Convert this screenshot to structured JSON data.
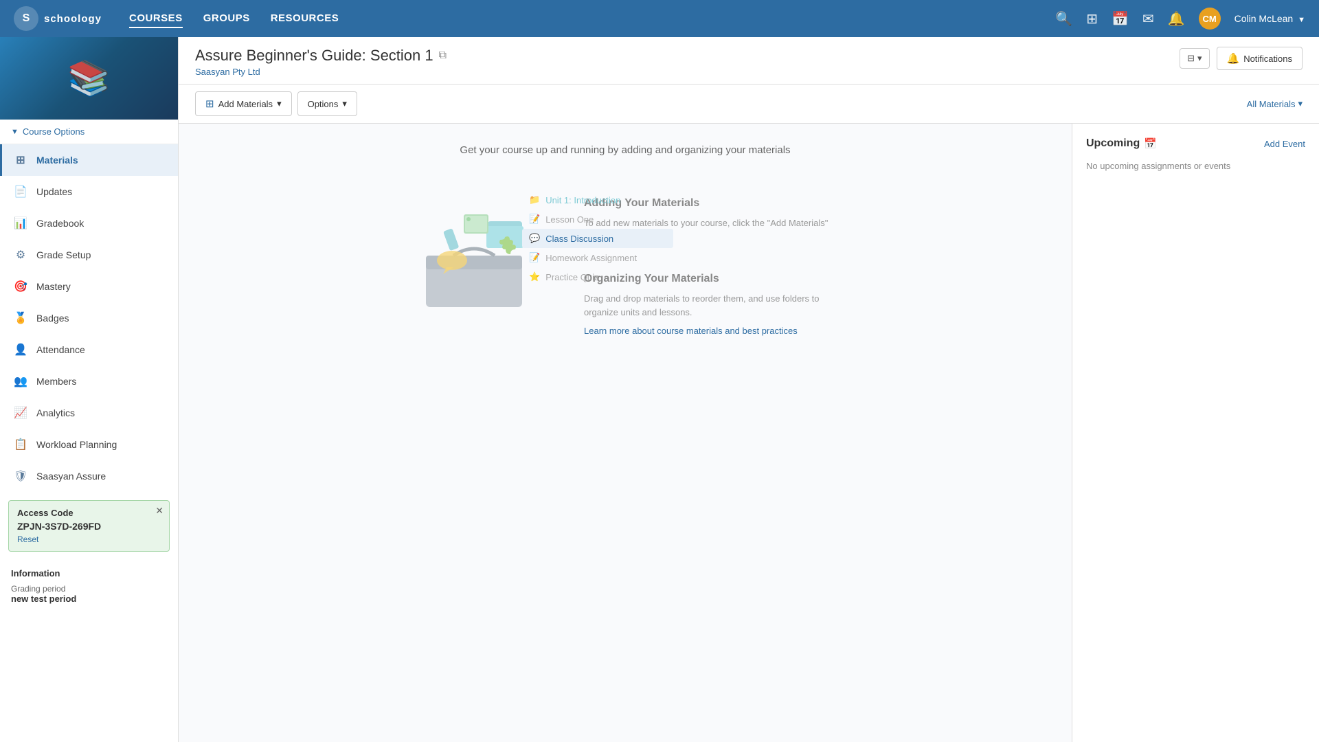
{
  "topNav": {
    "logo": "schoology",
    "links": [
      {
        "label": "COURSES",
        "active": true
      },
      {
        "label": "GROUPS",
        "active": false
      },
      {
        "label": "RESOURCES",
        "active": false
      }
    ],
    "user": {
      "name": "Colin McLean",
      "initials": "CM"
    },
    "icons": [
      "search",
      "apps",
      "calendar",
      "mail",
      "bell"
    ]
  },
  "pageHeader": {
    "title": "Assure Beginner's Guide: Section 1",
    "subtitle": "Saasyan Pty Ltd",
    "notificationsLabel": "Notifications"
  },
  "toolbar": {
    "addMaterials": "Add Materials",
    "options": "Options",
    "allMaterials": "All Materials"
  },
  "sidebar": {
    "courseOptions": "Course Options",
    "navItems": [
      {
        "label": "Materials",
        "icon": "grid",
        "active": true
      },
      {
        "label": "Updates",
        "icon": "file"
      },
      {
        "label": "Gradebook",
        "icon": "book"
      },
      {
        "label": "Grade Setup",
        "icon": "sliders"
      },
      {
        "label": "Mastery",
        "icon": "target"
      },
      {
        "label": "Badges",
        "icon": "badge"
      },
      {
        "label": "Attendance",
        "icon": "person"
      },
      {
        "label": "Members",
        "icon": "people"
      },
      {
        "label": "Analytics",
        "icon": "chart"
      },
      {
        "label": "Workload Planning",
        "icon": "calendar2"
      },
      {
        "label": "Saasyan Assure",
        "icon": "shield"
      }
    ],
    "accessCode": {
      "title": "Access Code",
      "value": "ZPJN-3S7D-269FD",
      "resetLabel": "Reset"
    },
    "information": {
      "title": "Information",
      "gradingPeriodLabel": "Grading period",
      "gradingPeriodValue": "new test period"
    }
  },
  "mainContent": {
    "emptyStateText": "Get your course up and running by adding and organizing your materials",
    "addingMaterials": {
      "title": "Adding Your Materials",
      "text": "To add new materials to your course, click the \"Add Materials\" dropdown menu."
    },
    "organizingMaterials": {
      "title": "Organizing Your Materials",
      "text": "Drag and drop materials to reorder them, and use folders to organize units and lessons.",
      "linkText": "Learn more about course materials and best practices"
    },
    "sampleItems": [
      {
        "label": "Unit 1: Introduction",
        "icon": "📁"
      },
      {
        "label": "Lesson One",
        "icon": "📝"
      },
      {
        "label": "Class Discussion",
        "icon": "💬"
      },
      {
        "label": "Homework Assignment",
        "icon": "📝"
      },
      {
        "label": "Practice Quiz",
        "icon": "⭐"
      }
    ]
  },
  "upcoming": {
    "title": "Upcoming",
    "addEventLabel": "Add Event",
    "noItemsText": "No upcoming assignments or events"
  }
}
